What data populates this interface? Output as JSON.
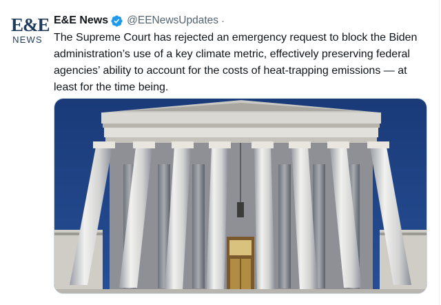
{
  "account": {
    "display_name": "E&E News",
    "handle": "@EENewsUpdates",
    "separator": "·",
    "avatar_logo": "E&E",
    "avatar_sub": "NEWS",
    "verified_icon": "verified-badge-icon",
    "verified_color": "#1d9bf0"
  },
  "tweet": {
    "text": "The Supreme Court has rejected an emergency request to block the Biden administration’s use of a key climate metric, effectively preserving federal agencies’ ability to account for the costs of heat-trapping emissions — at least for the time being."
  },
  "media": {
    "subject": "supreme-court-building-photo",
    "sky_color": "#1c3f7e"
  }
}
